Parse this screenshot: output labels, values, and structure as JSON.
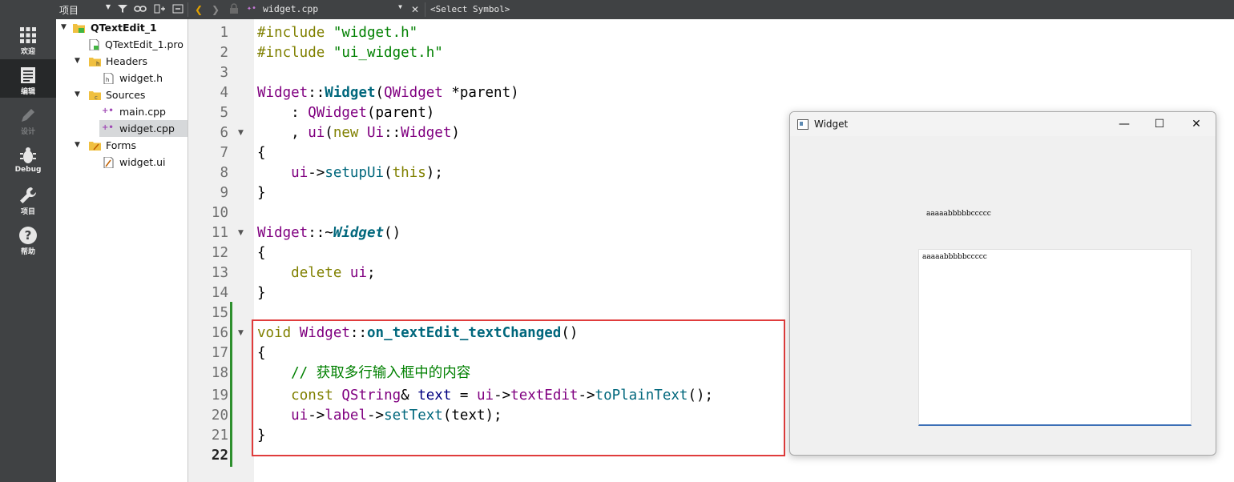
{
  "toolbar": {
    "project_selector": "项目",
    "file_selector": "widget.cpp",
    "symbol_selector": "<Select Symbol>"
  },
  "modes": [
    {
      "label": "欢迎",
      "icon": "grid-icon"
    },
    {
      "label": "编辑",
      "icon": "edit-document-icon"
    },
    {
      "label": "设计",
      "icon": "pencil-icon"
    },
    {
      "label": "Debug",
      "icon": "bug-icon"
    },
    {
      "label": "项目",
      "icon": "wrench-icon"
    },
    {
      "label": "帮助",
      "icon": "help-icon"
    }
  ],
  "tree": {
    "project": "QTextEdit_1",
    "pro_file": "QTextEdit_1.pro",
    "headers": "Headers",
    "header_file": "widget.h",
    "sources": "Sources",
    "source_main": "main.cpp",
    "source_widget": "widget.cpp",
    "forms": "Forms",
    "form_file": "widget.ui"
  },
  "editor": {
    "line_numbers": [
      "1",
      "2",
      "3",
      "4",
      "5",
      "6",
      "7",
      "8",
      "9",
      "10",
      "11",
      "12",
      "13",
      "14",
      "15",
      "16",
      "17",
      "18",
      "19",
      "20",
      "21",
      "22"
    ],
    "current_line": "22"
  },
  "code": {
    "l1": [
      "#include ",
      "\"widget.h\""
    ],
    "l2": [
      "#include ",
      "\"ui_widget.h\""
    ],
    "l4": [
      "Widget",
      "::",
      "Widget",
      "(",
      "QWidget",
      " *parent)"
    ],
    "l5": [
      "    : ",
      "QWidget",
      "(parent)"
    ],
    "l6": [
      "    , ",
      "ui",
      "(",
      "new",
      " ",
      "Ui",
      "::",
      "Widget",
      ")"
    ],
    "l7": [
      "{"
    ],
    "l8": [
      "    ",
      "ui",
      "->",
      "setupUi",
      "(",
      "this",
      ");"
    ],
    "l9": [
      "}"
    ],
    "l11": [
      "Widget",
      "::~",
      "Widget",
      "()"
    ],
    "l12": [
      "{"
    ],
    "l13": [
      "    ",
      "delete",
      " ",
      "ui",
      ";"
    ],
    "l14": [
      "}"
    ],
    "l16": [
      "void",
      " ",
      "Widget",
      "::",
      "on_textEdit_textChanged",
      "()"
    ],
    "l17": [
      "{"
    ],
    "l18": [
      "    // 获取多行输入框中的内容"
    ],
    "l19": [
      "    ",
      "const",
      " ",
      "QString",
      "& ",
      "text",
      " = ",
      "ui",
      "->",
      "textEdit",
      "->",
      "toPlainText",
      "();"
    ],
    "l20": [
      "    ",
      "ui",
      "->",
      "label",
      "->",
      "setText",
      "(text);"
    ],
    "l21": [
      "}"
    ]
  },
  "widget_window": {
    "title": "Widget",
    "minimize": "—",
    "maximize": "☐",
    "close": "✕",
    "label_text": "aaaaabbbbbccccc",
    "textedit_value": "aaaaabbbbbccccc"
  },
  "colors": {
    "keyword": "#808000",
    "string": "#008000",
    "type": "#800080",
    "function": "#00677c",
    "highlight_border": "#e03c3c",
    "sidebar": "#404244"
  }
}
